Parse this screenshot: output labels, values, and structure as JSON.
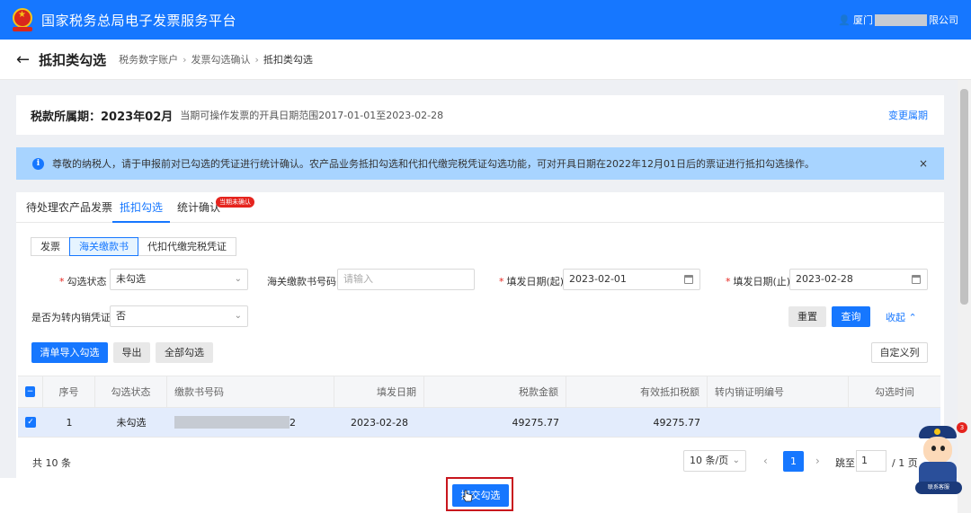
{
  "app": {
    "title": "国家税务总局电子发票服务平台",
    "user_prefix": "厦门",
    "user_suffix": "限公司",
    "user_icon": "user-icon"
  },
  "header": {
    "page_title": "抵扣类勾选",
    "back_icon": "back-arrow-icon",
    "breadcrumbs": [
      "税务数字账户",
      "发票勾选确认",
      "抵扣类勾选"
    ]
  },
  "period": {
    "label": "税款所属期：2023年02月",
    "hint": "当期可操作发票的开具日期范围2017-01-01至2023-02-28",
    "change": "变更属期"
  },
  "notice": {
    "icon": "info-icon",
    "text": "尊敬的纳税人，请于申报前对已勾选的凭证进行统计确认。农产品业务抵扣勾选和代扣代缴完税凭证勾选功能，可对开具日期在2022年12月01日后的票证进行抵扣勾选操作。",
    "close": "×"
  },
  "tabs": [
    {
      "label": "待处理农产品发票"
    },
    {
      "label": "抵扣勾选",
      "active": true
    },
    {
      "label": "统计确认",
      "badge": "当期未确认"
    }
  ],
  "segments": [
    {
      "label": "发票"
    },
    {
      "label": "海关缴款书",
      "active": true
    },
    {
      "label": "代扣代缴完税凭证"
    }
  ],
  "filters": {
    "status": {
      "label": "勾选状态",
      "value": "未勾选"
    },
    "number": {
      "label": "海关缴款书号码",
      "placeholder": "请输入"
    },
    "date_from": {
      "label": "填发日期(起)",
      "value": "2023-02-01"
    },
    "date_to": {
      "label": "填发日期(止)",
      "value": "2023-02-28"
    },
    "transfer": {
      "label": "是否为转内销凭证",
      "value": "否"
    }
  },
  "buttons": {
    "reset": "重置",
    "query": "查询",
    "collapse": "收起",
    "import": "清单导入勾选",
    "export": "导出",
    "select_all": "全部勾选",
    "custom_cols": "自定义列"
  },
  "table": {
    "columns": [
      "序号",
      "勾选状态",
      "缴款书号码",
      "填发日期",
      "税款金额",
      "有效抵扣税额",
      "转内销证明编号",
      "勾选时间"
    ],
    "rows": [
      {
        "index": "1",
        "status": "未勾选",
        "number_tail": "2",
        "date": "2023-02-28",
        "tax": "49275.77",
        "deductible": "49275.77",
        "transfer_no": "",
        "time": ""
      }
    ]
  },
  "pagination": {
    "total": "共 10 条",
    "page_size": "10 条/页",
    "current": "1",
    "jump_label": "跳至",
    "jump_value": "1",
    "total_pages": "/ 1 页"
  },
  "footer": {
    "submit": "提交勾选"
  },
  "mascot": {
    "badge": "3",
    "label": "联系客服"
  }
}
